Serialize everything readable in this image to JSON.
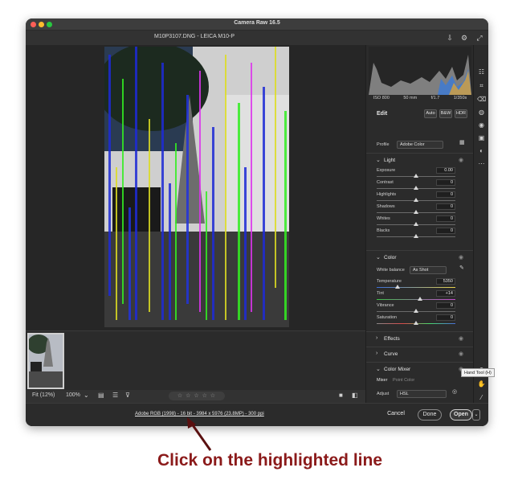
{
  "window": {
    "title": "Camera Raw 16.5"
  },
  "file": {
    "name": "M10P3107.DNG  -  LEICA M10-P"
  },
  "exif": [
    "ISO 800",
    "50 mm",
    "f/1.7",
    "1/350s"
  ],
  "edit": {
    "title": "Edit",
    "buttons": [
      "Auto",
      "B&W",
      "HDR"
    ],
    "profile_label": "Profile",
    "profile_value": "Adobe Color"
  },
  "light": {
    "title": "Light",
    "sliders": [
      {
        "label": "Exposure",
        "value": "0.00",
        "pos": 0.5
      },
      {
        "label": "Contrast",
        "value": "0",
        "pos": 0.5
      },
      {
        "label": "Highlights",
        "value": "0",
        "pos": 0.5
      },
      {
        "label": "Shadows",
        "value": "0",
        "pos": 0.5
      },
      {
        "label": "Whites",
        "value": "0",
        "pos": 0.5
      },
      {
        "label": "Blacks",
        "value": "0",
        "pos": 0.5
      }
    ]
  },
  "color": {
    "title": "Color",
    "wb_label": "White balance",
    "wb_value": "As Shot",
    "sliders": [
      {
        "label": "Temperature",
        "value": "5350",
        "pos": 0.27
      },
      {
        "label": "Tint",
        "value": "+14",
        "pos": 0.55
      },
      {
        "label": "Vibrance",
        "value": "0",
        "pos": 0.5
      },
      {
        "label": "Saturation",
        "value": "0",
        "pos": 0.5
      }
    ]
  },
  "sections": {
    "effects": "Effects",
    "curve": "Curve",
    "color_mixer": "Color Mixer"
  },
  "mixer": {
    "tabs": [
      "Mixer",
      "Point Color"
    ],
    "adjust_label": "Adjust",
    "adjust_value": "HSL",
    "subtabs": [
      "Hue",
      "Saturation",
      "Luminance",
      "All"
    ]
  },
  "toolbar": {
    "zoom_fit": "Fit (12%)",
    "zoom_100": "100%",
    "stars": "☆ ☆ ☆ ☆ ☆"
  },
  "workflow": "Adobe RGB (1998) - 16 bit - 3984 x 5976 (23.8MP) - 300 ppi",
  "actions": {
    "cancel": "Cancel",
    "done": "Done",
    "open": "Open"
  },
  "tooltip": "Hand Tool (H)",
  "annotation": "Click on the highlighted line",
  "colors": {
    "accent_annotation": "#8b1a1a",
    "panel_bg": "#2b2b2b"
  }
}
